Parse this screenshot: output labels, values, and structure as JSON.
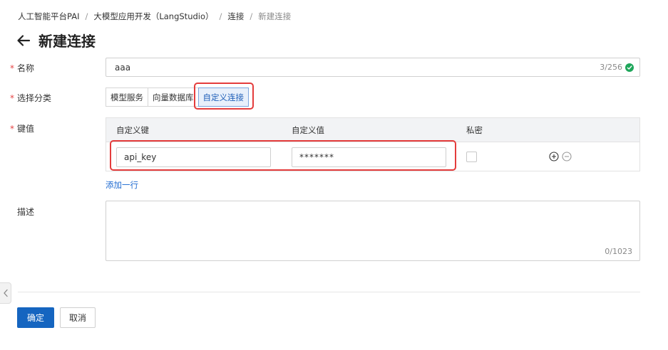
{
  "breadcrumb": {
    "items": [
      "人工智能平台PAI",
      "大模型应用开发（LangStudio）",
      "连接"
    ],
    "current": "新建连接",
    "separator": "/"
  },
  "page": {
    "title": "新建连接"
  },
  "form": {
    "name": {
      "label": "名称",
      "value": "aaa",
      "count": "3/256"
    },
    "category": {
      "label": "选择分类",
      "options": [
        "模型服务",
        "向量数据库",
        "自定义连接"
      ],
      "selected": "自定义连接"
    },
    "kv": {
      "label": "键值",
      "headers": {
        "key": "自定义键",
        "value": "自定义值",
        "secret": "私密"
      },
      "rows": [
        {
          "key": "api_key",
          "value": "*******",
          "secret": false
        }
      ],
      "add_row_label": "添加一行"
    },
    "description": {
      "label": "描述",
      "count": "0/1023"
    }
  },
  "actions": {
    "confirm_label": "确定",
    "cancel_label": "取消"
  },
  "colors": {
    "primary": "#1565c0",
    "required": "#e54545",
    "highlight": "#e43c3c",
    "success": "#1ea65a",
    "link": "#1f6bd1"
  }
}
